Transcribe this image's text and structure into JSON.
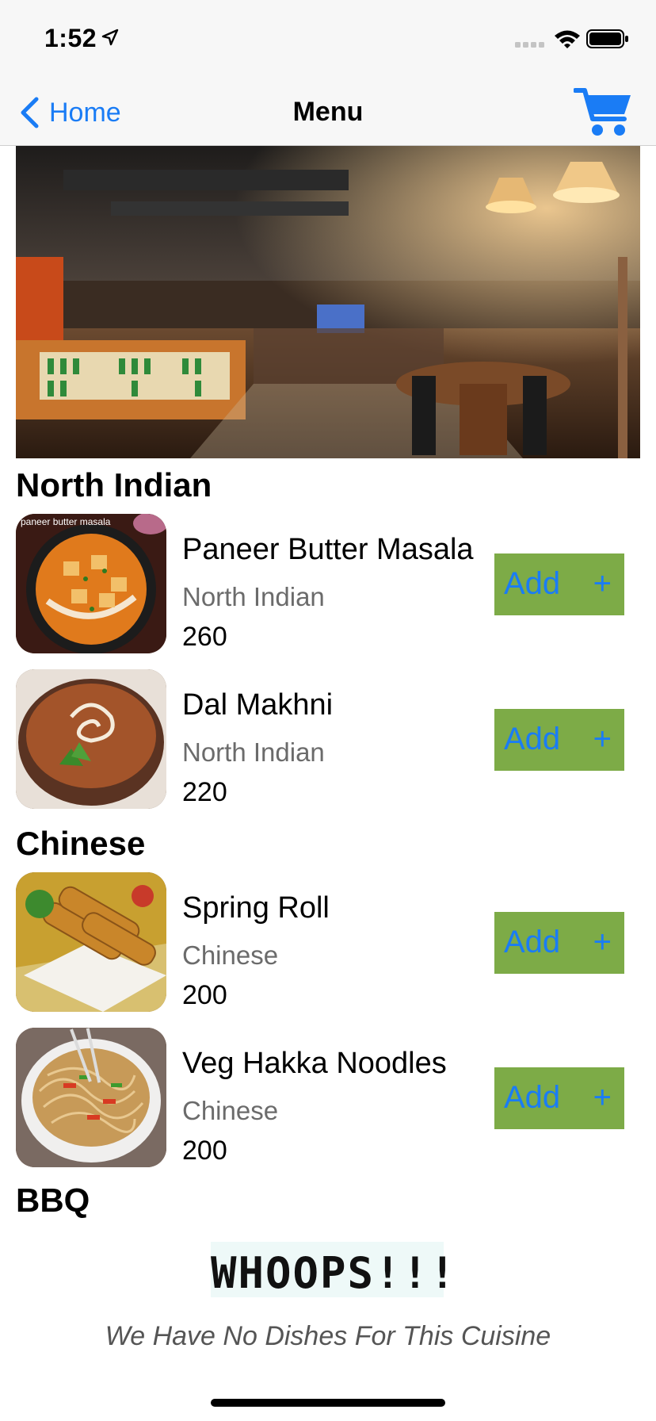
{
  "status_bar": {
    "time": "1:52"
  },
  "nav": {
    "back_label": "Home",
    "title": "Menu"
  },
  "sections": [
    {
      "title": "North Indian"
    },
    {
      "title": "Chinese"
    },
    {
      "title": "BBQ"
    }
  ],
  "dishes": [
    {
      "name": "Paneer Butter Masala",
      "cuisine": "North Indian",
      "price": "260",
      "thumb_caption": "paneer butter masala"
    },
    {
      "name": "Dal Makhni",
      "cuisine": "North Indian",
      "price": "220"
    },
    {
      "name": "Spring Roll",
      "cuisine": "Chinese",
      "price": "200"
    },
    {
      "name": "Veg Hakka Noodles",
      "cuisine": "Chinese",
      "price": "200"
    }
  ],
  "add_button": {
    "label": "Add",
    "plus": "+"
  },
  "empty_state": {
    "heading": "WHOOPS!!!",
    "message": "We Have No Dishes For This Cuisine"
  },
  "colors": {
    "accent": "#1a7cf5",
    "add_bg": "#7dab47",
    "subtext": "#6b6b6b"
  }
}
